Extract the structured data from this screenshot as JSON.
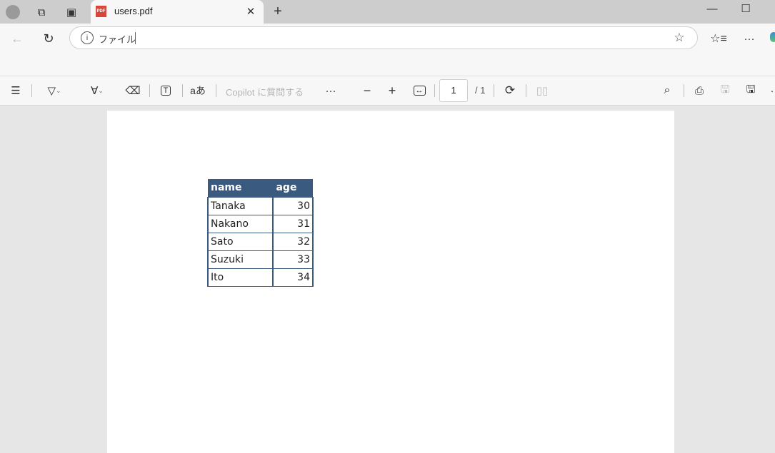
{
  "tab": {
    "title": "users.pdf",
    "icon": "pdf-icon"
  },
  "address": {
    "label": "ファイル",
    "value": ""
  },
  "toolbar": {
    "copilot": "Copilot に質問する",
    "page_current": "1",
    "page_total": "/ 1"
  },
  "table": {
    "headers": [
      "name",
      "age"
    ],
    "rows": [
      [
        "Tanaka",
        "30"
      ],
      [
        "Nakano",
        "31"
      ],
      [
        "Sato",
        "32"
      ],
      [
        "Suzuki",
        "33"
      ],
      [
        "Ito",
        "34"
      ]
    ]
  },
  "colors": {
    "table_header": "#3b5a80",
    "pdf_badge": "#d9453a"
  }
}
